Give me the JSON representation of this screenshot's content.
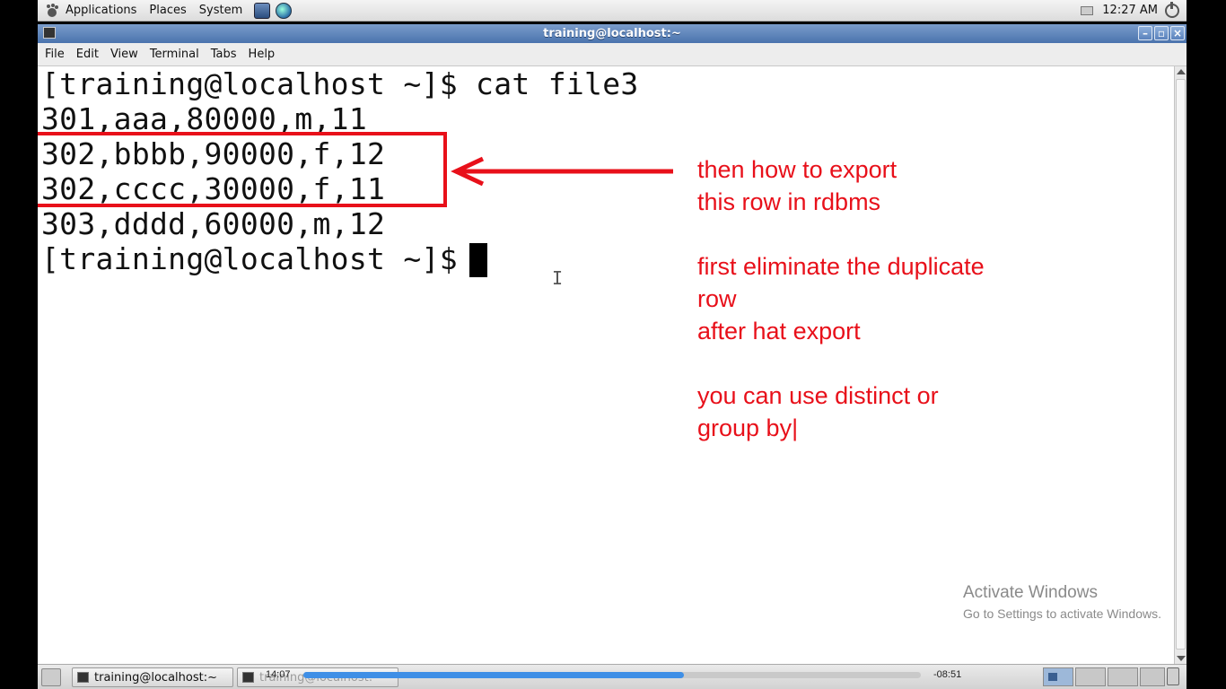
{
  "top_panel": {
    "menus": [
      "Applications",
      "Places",
      "System"
    ],
    "clock": "12:27 AM"
  },
  "window": {
    "title": "training@localhost:~"
  },
  "menubar": {
    "items": [
      "File",
      "Edit",
      "View",
      "Terminal",
      "Tabs",
      "Help"
    ]
  },
  "terminal": {
    "lines": [
      "[training@localhost ~]$ cat file3",
      "301,aaa,80000,m,11",
      "302,bbbb,90000,f,12",
      "302,cccc,30000,f,11",
      "303,dddd,60000,m,12",
      "[training@localhost ~]$ "
    ]
  },
  "annotation": {
    "notes": [
      "then how to export",
      "this row in rdbms",
      "first eliminate the duplicate",
      "row",
      "after hat export",
      "you can use distinct or",
      "group by|"
    ],
    "color": "#e8101a"
  },
  "watermark": {
    "title": "Activate Windows",
    "subtitle": "Go to Settings to activate Windows."
  },
  "taskbar": {
    "tasks": [
      "training@localhost:~",
      "training@localhost:~"
    ]
  },
  "player": {
    "elapsed": "14:07",
    "remaining": "-08:51",
    "progress_fraction": 0.616
  }
}
